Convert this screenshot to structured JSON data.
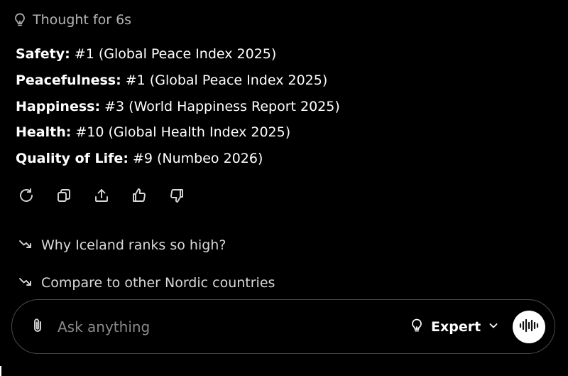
{
  "thought": {
    "label": "Thought for 6s",
    "icon": "lightbulb-icon"
  },
  "answer": {
    "items": [
      {
        "key": "Safety:",
        "value": " #1 (Global Peace Index 2025)"
      },
      {
        "key": "Peacefulness:",
        "value": " #1 (Global Peace Index 2025)"
      },
      {
        "key": "Happiness:",
        "value": " #3 (World Happiness Report 2025)"
      },
      {
        "key": "Health:",
        "value": " #10 (Global Health Index 2025)"
      },
      {
        "key": "Quality of Life:",
        "value": " #9 (Numbeo 2026)"
      }
    ]
  },
  "actions": {
    "icons": [
      "regenerate-icon",
      "copy-icon",
      "share-icon",
      "thumbs-up-icon",
      "thumbs-down-icon"
    ]
  },
  "suggestions": [
    {
      "label": "Why Iceland ranks so high?",
      "icon": "follow-up-arrow-icon"
    },
    {
      "label": "Compare to other Nordic countries",
      "icon": "follow-up-arrow-icon"
    }
  ],
  "composer": {
    "placeholder": "Ask anything",
    "value": "",
    "mode_label": "Expert",
    "attach_icon": "paperclip-icon",
    "voice_icon": "voice-waveform-icon"
  },
  "colors": {
    "background": "#000000",
    "text": "#ffffff",
    "muted": "#b4b4b4",
    "placeholder": "#8a8a8a",
    "border": "#4a4a4a"
  }
}
